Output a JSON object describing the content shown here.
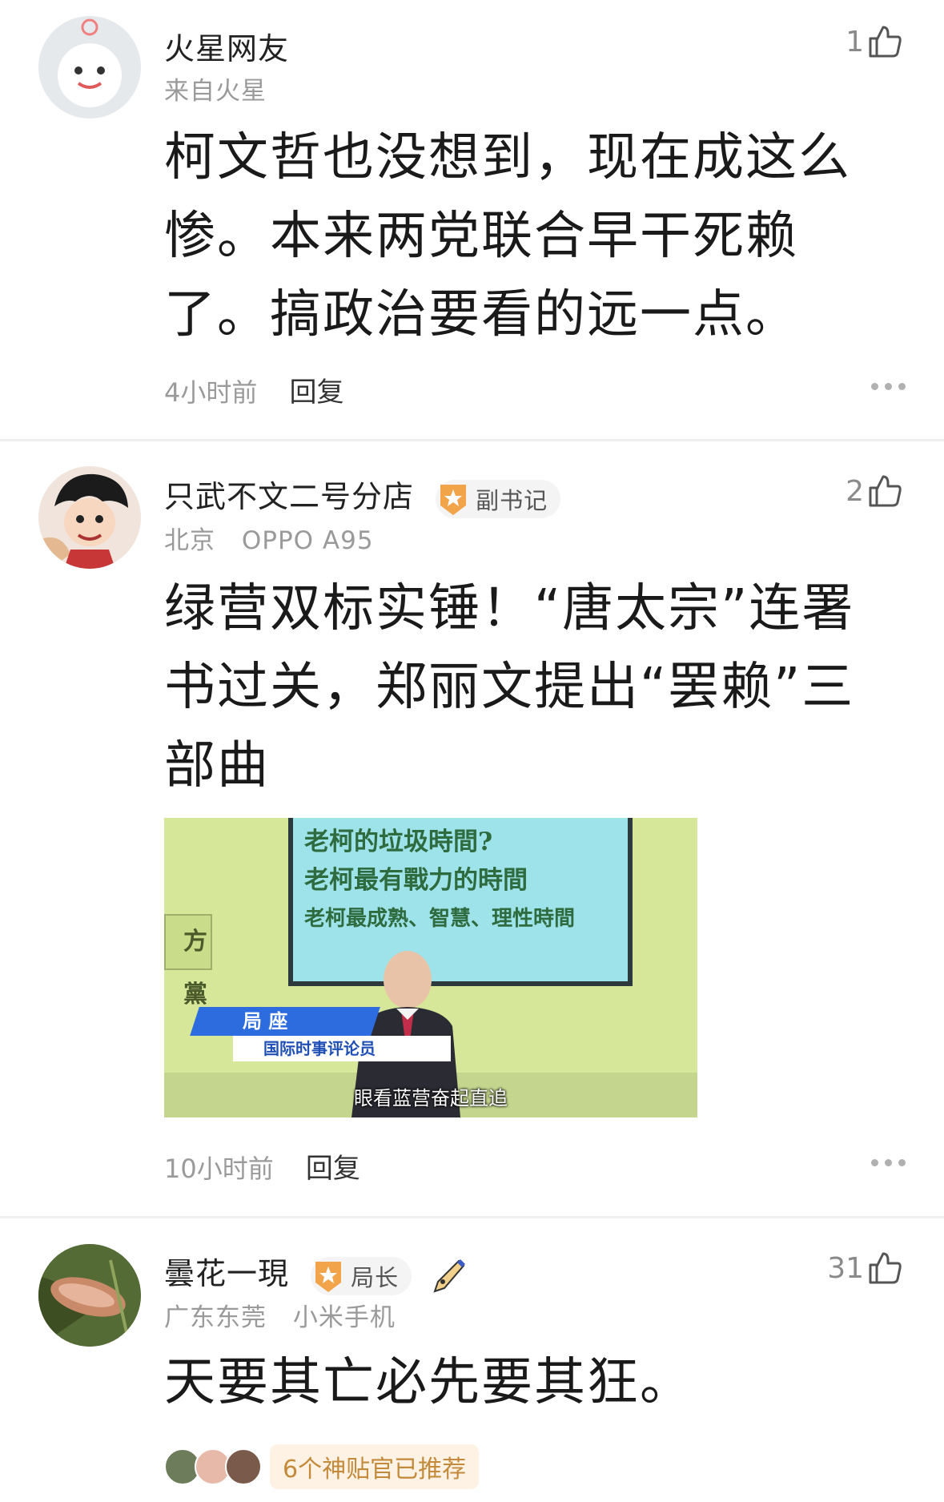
{
  "comments": [
    {
      "username": "火星网友",
      "meta": [
        "来自火星"
      ],
      "likes": "1",
      "body": "柯文哲也没想到，现在成这么惨。本来两党联合早干死赖了。搞政治要看的远一点。",
      "time": "4小时前",
      "reply_label": "回复"
    },
    {
      "username": "只武不文二号分店",
      "badge": "副书记",
      "meta": [
        "北京",
        "OPPO A95"
      ],
      "likes": "2",
      "body": "绿营双标实锤！“唐太宗”连署书过关，郑丽文提出“罢赖”三部曲",
      "video": {
        "screen_lines": [
          "老柯的垃圾時間?",
          "老柯最有戰力的時間",
          "老柯最成熟、智慧、理性時間"
        ],
        "side_sign": "方黨",
        "name_tag": "局 座",
        "title_tag": "国际时事评论员",
        "subtitle": "眼看蓝营奋起直追"
      },
      "time": "10小时前",
      "reply_label": "回复"
    },
    {
      "username": "曇花一現",
      "badge": "局长",
      "meta": [
        "广东东莞",
        "小米手机"
      ],
      "likes": "31",
      "body": "天要其亡必先要其狂。",
      "recommend_text": "6个神贴官已推荐"
    }
  ]
}
